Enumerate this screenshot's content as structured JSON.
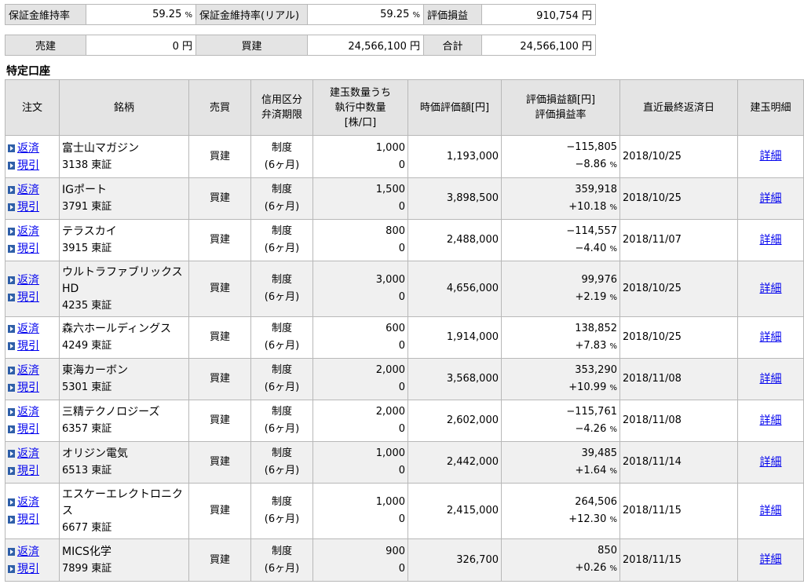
{
  "summary": {
    "margin_ratio_label": "保証金維持率",
    "margin_ratio_value": "59.25",
    "margin_ratio_real_label": "保証金維持率(リアル)",
    "margin_ratio_real_value": "59.25",
    "percent_unit": "%",
    "valuation_pl_label": "評価損益",
    "valuation_pl_value": "910,754",
    "yen_unit": "円",
    "sell_label": "売建",
    "sell_value": "0",
    "buy_label": "買建",
    "buy_value": "24,566,100",
    "total_label": "合計",
    "total_value": "24,566,100"
  },
  "section_title": "特定口座",
  "table": {
    "headers": {
      "order": "注文",
      "stock": "銘柄",
      "side": "売買",
      "credit_l1": "信用区分",
      "credit_l2": "弁済期限",
      "qty_l1": "建玉数量うち",
      "qty_l2": "執行中数量",
      "qty_l3": "[株/口]",
      "value": "時価評価額[円]",
      "pl_l1": "評価損益額[円]",
      "pl_l2": "評価損益率",
      "date": "直近最終返済日",
      "detail": "建玉明細"
    },
    "close_label": "返済",
    "delivery_label": "現引",
    "detail_label": "詳細",
    "pct_unit": "%",
    "rows": [
      {
        "name": "富士山マガジン",
        "code": "3138 東証",
        "side": "買建",
        "credit": "制度",
        "term": "(6ヶ月)",
        "qty": "1,000",
        "exec": "0",
        "value": "1,193,000",
        "pl": "−115,805",
        "rate": "−8.86",
        "date": "2018/10/25"
      },
      {
        "name": "IGポート",
        "code": "3791 東証",
        "side": "買建",
        "credit": "制度",
        "term": "(6ヶ月)",
        "qty": "1,500",
        "exec": "0",
        "value": "3,898,500",
        "pl": "359,918",
        "rate": "+10.18",
        "date": "2018/10/25"
      },
      {
        "name": "テラスカイ",
        "code": "3915 東証",
        "side": "買建",
        "credit": "制度",
        "term": "(6ヶ月)",
        "qty": "800",
        "exec": "0",
        "value": "2,488,000",
        "pl": "−114,557",
        "rate": "−4.40",
        "date": "2018/11/07"
      },
      {
        "name": "ウルトラファブリックスHD",
        "code": "4235 東証",
        "side": "買建",
        "credit": "制度",
        "term": "(6ヶ月)",
        "qty": "3,000",
        "exec": "0",
        "value": "4,656,000",
        "pl": "99,976",
        "rate": "+2.19",
        "date": "2018/10/25"
      },
      {
        "name": "森六ホールディングス",
        "code": "4249 東証",
        "side": "買建",
        "credit": "制度",
        "term": "(6ヶ月)",
        "qty": "600",
        "exec": "0",
        "value": "1,914,000",
        "pl": "138,852",
        "rate": "+7.83",
        "date": "2018/10/25"
      },
      {
        "name": "東海カーボン",
        "code": "5301 東証",
        "side": "買建",
        "credit": "制度",
        "term": "(6ヶ月)",
        "qty": "2,000",
        "exec": "0",
        "value": "3,568,000",
        "pl": "353,290",
        "rate": "+10.99",
        "date": "2018/11/08"
      },
      {
        "name": "三精テクノロジーズ",
        "code": "6357 東証",
        "side": "買建",
        "credit": "制度",
        "term": "(6ヶ月)",
        "qty": "2,000",
        "exec": "0",
        "value": "2,602,000",
        "pl": "−115,761",
        "rate": "−4.26",
        "date": "2018/11/08"
      },
      {
        "name": "オリジン電気",
        "code": "6513 東証",
        "side": "買建",
        "credit": "制度",
        "term": "(6ヶ月)",
        "qty": "1,000",
        "exec": "0",
        "value": "2,442,000",
        "pl": "39,485",
        "rate": "+1.64",
        "date": "2018/11/14"
      },
      {
        "name": "エスケーエレクトロニクス",
        "code": "6677 東証",
        "side": "買建",
        "credit": "制度",
        "term": "(6ヶ月)",
        "qty": "1,000",
        "exec": "0",
        "value": "2,415,000",
        "pl": "264,506",
        "rate": "+12.30",
        "date": "2018/11/15"
      },
      {
        "name": "MICS化学",
        "code": "7899 東証",
        "side": "買建",
        "credit": "制度",
        "term": "(6ヶ月)",
        "qty": "900",
        "exec": "0",
        "value": "326,700",
        "pl": "850",
        "rate": "+0.26",
        "date": "2018/11/15"
      }
    ]
  }
}
